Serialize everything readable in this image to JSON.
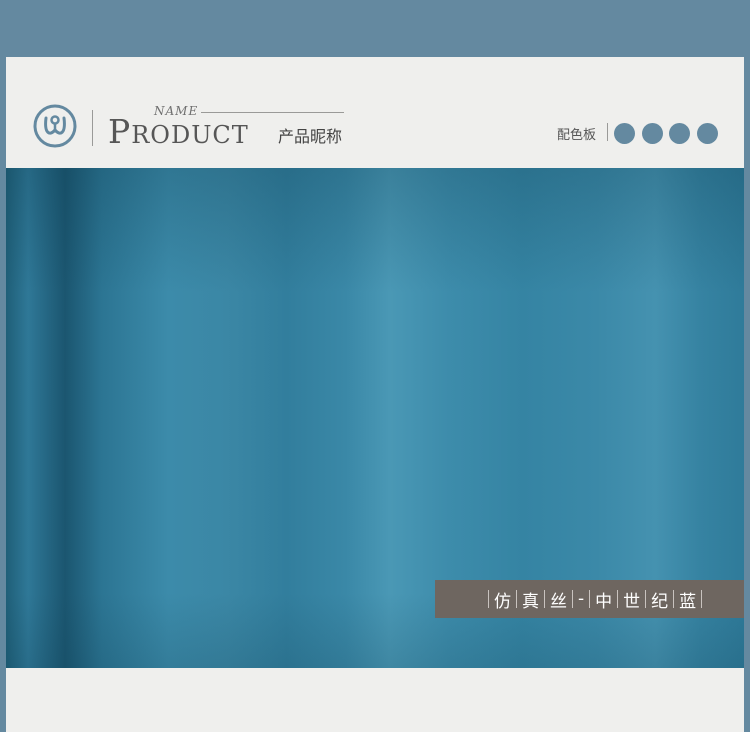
{
  "header": {
    "logo_icon": "omega-infinity-logo-icon",
    "name_label": "NAME",
    "product_title_first": "P",
    "product_title_rest": "RODUCT",
    "product_nickname": "产品昵称",
    "palette_label": "配色板",
    "swatches": [
      "#6489a0",
      "#6489a0",
      "#6489a0",
      "#6489a0"
    ]
  },
  "image": {
    "subject": "blue-satin-fabric",
    "base_color": "#3f8aa8"
  },
  "label": {
    "chars": [
      "仿",
      "真",
      "丝",
      "-",
      "中",
      "世",
      "纪",
      "蓝"
    ],
    "bar_color": "#6e6660"
  },
  "colors": {
    "page_background": "#6489a0",
    "card_background": "#efefed"
  }
}
